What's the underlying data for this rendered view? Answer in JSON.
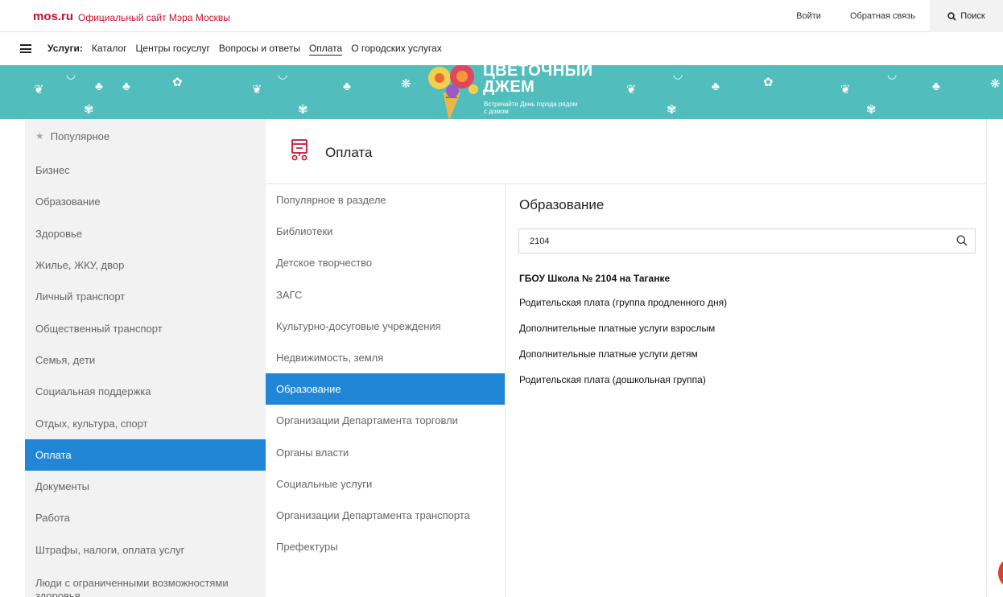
{
  "topbar": {
    "logo": "mos.ru",
    "site_title": "Официальный сайт Мэра Москвы",
    "login": "Войти",
    "feedback": "Обратная связь",
    "search_label": "Поиск"
  },
  "nav": {
    "label": "Услуги:",
    "items": [
      "Каталог",
      "Центры госуслуг",
      "Вопросы и ответы",
      "Оплата",
      "О городских услугах"
    ],
    "active": "Оплата"
  },
  "banner": {
    "title_line1": "ЦВЕТОЧНЫЙ",
    "title_line2": "ДЖЕМ",
    "subtitle": "Встречайте День города рядом с домом"
  },
  "sidebar": {
    "items": [
      "Популярное",
      "Бизнес",
      "Образование",
      "Здоровье",
      "Жилье, ЖКУ, двор",
      "Личный транспорт",
      "Общественный транспорт",
      "Семья, дети",
      "Социальная поддержка",
      "Отдых, культура, спорт",
      "Оплата",
      "Документы",
      "Работа",
      "Штрафы, налоги, оплата услуг",
      "Люди с ограниченными возможностями здоровья"
    ],
    "active": "Оплата"
  },
  "section": {
    "title": "Оплата"
  },
  "subcategories": {
    "items": [
      "Популярное в разделе",
      "Библиотеки",
      "Детское творчество",
      "ЗАГС",
      "Культурно-досуговые учреждения",
      "Недвижимость, земля",
      "Образование",
      "Организации Департамента торговли",
      "Органы власти",
      "Социальные услуги",
      "Организации Департамента транспорта",
      "Префектуры"
    ],
    "active": "Образование"
  },
  "panel": {
    "title": "Образование",
    "search_value": "2104",
    "org_name": "ГБОУ Школа № 2104 на Таганке",
    "services": [
      "Родительская плата (группа продленного дня)",
      "Дополнительные платные услуги взрослым",
      "Дополнительные платные услуги детям",
      "Родительская плата (дошкольная группа)"
    ]
  },
  "colors": {
    "brand_red": "#c8102e",
    "active_blue": "#2286d6",
    "banner_teal": "#52bdbd"
  }
}
